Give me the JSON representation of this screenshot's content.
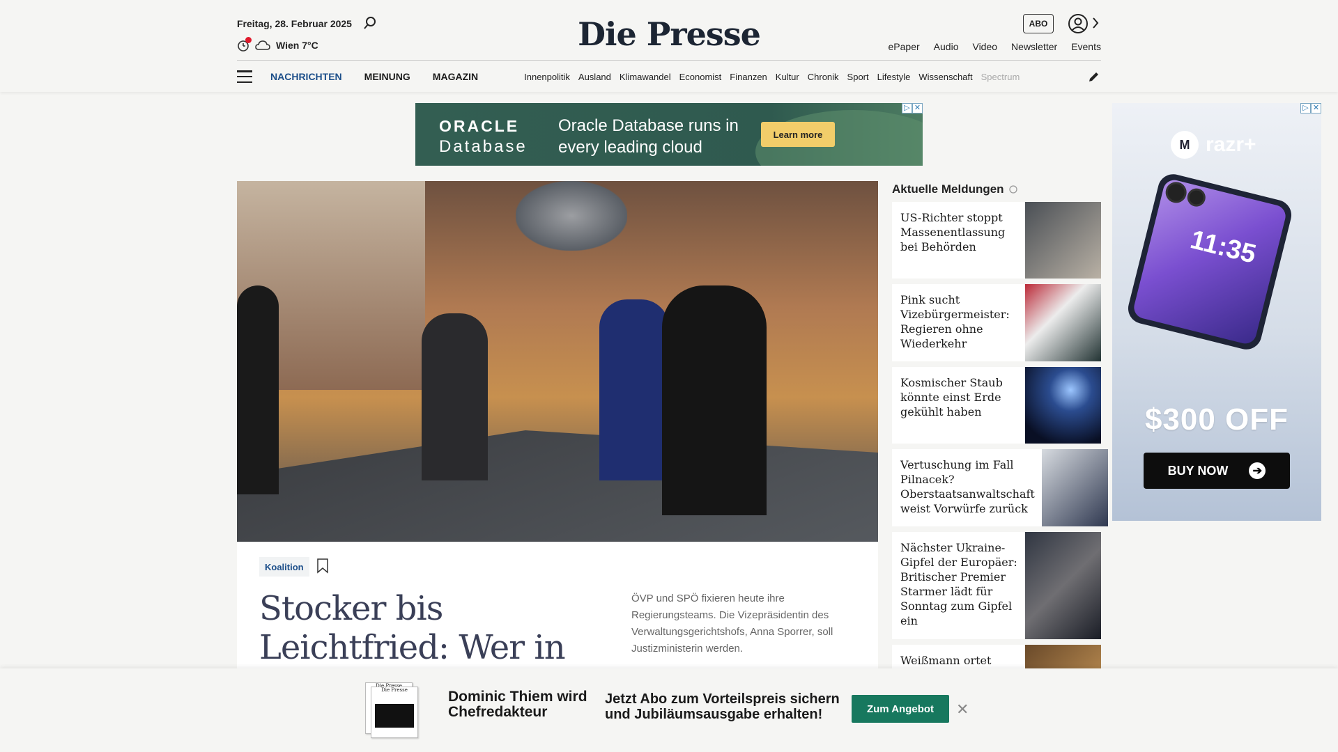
{
  "header": {
    "date": "Freitag, 28. Februar 2025",
    "weather": "Wien 7°C",
    "logo": "Die Presse",
    "abo_label": "ABO",
    "quick_links": [
      "ePaper",
      "Audio",
      "Video",
      "Newsletter",
      "Events"
    ]
  },
  "nav": {
    "main": [
      "NACHRICHTEN",
      "MEINUNG",
      "MAGAZIN"
    ],
    "sub": [
      "Innenpolitik",
      "Ausland",
      "Klimawandel",
      "Economist",
      "Finanzen",
      "Kultur",
      "Chronik",
      "Sport",
      "Lifestyle",
      "Wissenschaft",
      "Spectrum"
    ]
  },
  "ad_banner": {
    "brand_line1": "ORACLE",
    "brand_line2": "Database",
    "headline": "Oracle Database runs in every leading cloud",
    "cta": "Learn more"
  },
  "ad_right": {
    "brand": "razr+",
    "phone_time": "11:35",
    "offer": "$300 OFF",
    "cta": "BUY NOW"
  },
  "lead": {
    "tag": "Koalition",
    "headline": "Stocker bis Leichtfried: Wer in der neuen",
    "teaser": "ÖVP und SPÖ fixieren heute ihre Regierungsteams. Die Vizepräsidentin des Verwaltungsgerichtshofs, Anna Sporrer, soll Justizministerin werden."
  },
  "news": {
    "title": "Aktuelle Meldungen",
    "items": [
      {
        "text": "US-Richter stoppt Massenentlassung bei Behörden"
      },
      {
        "text": "Pink sucht Vizebürgermeister: Regieren ohne Wiederkehr"
      },
      {
        "text": "Kosmischer Staub könnte einst Erde gekühlt haben"
      },
      {
        "text": "Vertuschung im Fall Pilnacek? Oberstaatsanwaltschaft weist Vorwürfe zurück"
      },
      {
        "text": "Nächster Ukraine-Gipfel der Europäer: Britischer Premier Starmer lädt für Sonntag zum Gipfel ein"
      },
      {
        "text": "Weißmann ortet"
      }
    ]
  },
  "promo": {
    "line1": "Dominic Thiem wird Chefredakteur",
    "line2": "Jetzt Abo zum Vorteilspreis sichern und Jubiläumsausgabe erhalten!",
    "cta": "Zum Angebot",
    "paper_name": "Die Presse"
  }
}
